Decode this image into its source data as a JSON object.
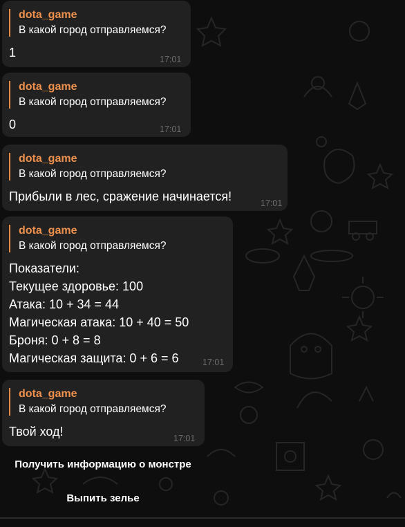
{
  "messages": [
    {
      "reply_author": "dota_game",
      "reply_text": "В какой город отправляемся?",
      "text": "1",
      "time": "17:01"
    },
    {
      "reply_author": "dota_game",
      "reply_text": "В какой город отправляемся?",
      "text": "0",
      "time": "17:01"
    },
    {
      "reply_author": "dota_game",
      "reply_text": "В какой город отправляемся?",
      "text": "Прибыли в лес, сражение начинается!",
      "time": "17:01"
    },
    {
      "reply_author": "dota_game",
      "reply_text": "В какой город отправляемся?",
      "text": "Показатели:\nТекущее здоровье: 100\nАтака: 10 + 34 = 44\nМагическая атака: 10 + 40 = 50\nБроня: 0 + 8 = 8\nМагическая защита: 0 + 6 = 6",
      "time": "17:01"
    },
    {
      "reply_author": "dota_game",
      "reply_text": "В какой город отправляемся?",
      "text": "Твой ход!",
      "time": "17:01"
    }
  ],
  "keyboard": {
    "monster_info_label": "Получить информацию о монстре",
    "drink_potion_label": "Выпить зелье"
  },
  "colors": {
    "background": "#0e0e0e",
    "bubble": "#212121",
    "reply_accent": "#f0914d",
    "timestamp": "#6c6c6c",
    "text": "#ffffff"
  }
}
